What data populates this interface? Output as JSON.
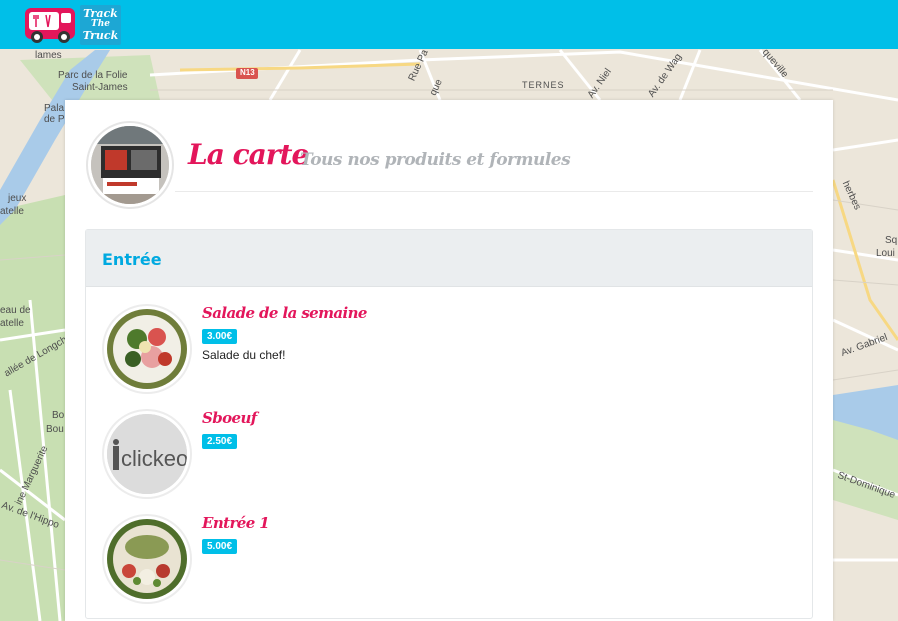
{
  "header": {
    "logo_text": [
      "Track",
      "The",
      "Truck"
    ],
    "brand_color": "#00bfe8",
    "accent_color": "#e3165b"
  },
  "map": {
    "labels": [
      "Parc de la Folie",
      "Saint-James",
      "Pala",
      "de P",
      "N13",
      "Rue Pa",
      "que",
      "TERNES",
      "Av. Niel",
      "Av. de Wag",
      "queville",
      "jeux",
      "atelle",
      "eau de",
      "atelle",
      "allée de Longcha",
      "Bo",
      "Bou",
      "ine Marguerite",
      "Av. de l'Hippo",
      "lames",
      "Sq",
      "Loui",
      "Av. Gabriel",
      "herbes",
      "St-Dominique"
    ]
  },
  "page": {
    "title": "La carte",
    "subtitle": "Tous nos produits et formules"
  },
  "section": {
    "title": "Entrée",
    "items": [
      {
        "name": "Salade de la semaine",
        "price": "3.00€",
        "description": "Salade du chef!"
      },
      {
        "name": "Sboeuf",
        "price": "2.50€",
        "description": ""
      },
      {
        "name": "Entrée 1",
        "price": "5.00€",
        "description": ""
      }
    ]
  }
}
